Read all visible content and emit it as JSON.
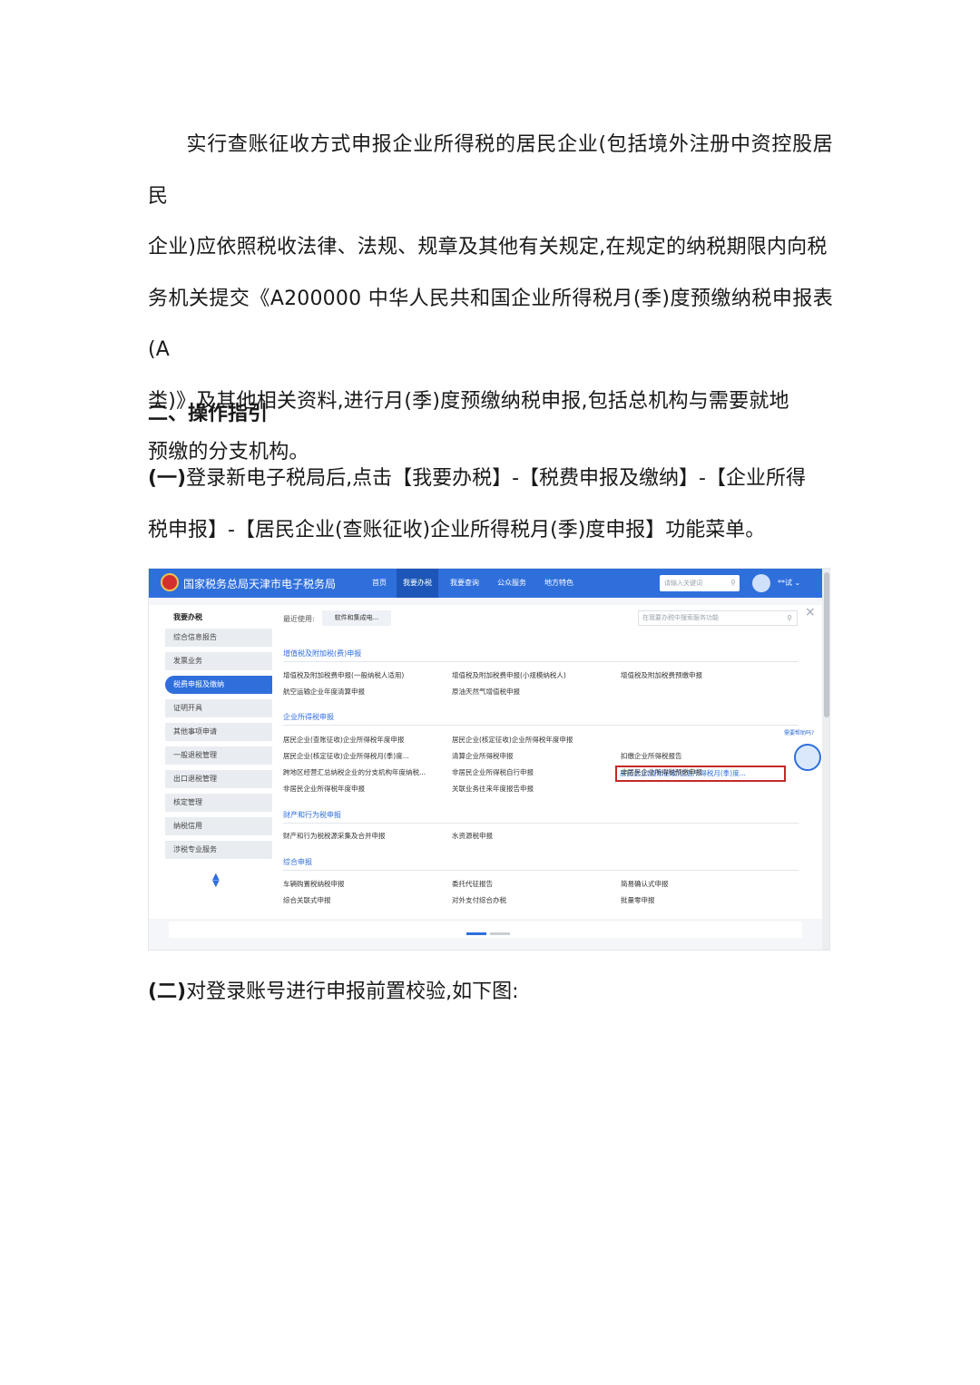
{
  "paragraph": {
    "lines": [
      "实行查账征收方式申报企业所得税的居民企业(包括境外注册中资控股居民",
      "企业)应依照税收法律、法规、规章及其他有关规定,在规定的纳税期限内向税",
      "务机关提交《A200000 中华人民共和国企业所得税月(季)度预缴纳税申报表(A",
      "类)》及其他相关资料,进行月(季)度预缴纳税申报,包括总机构与需要就地",
      "预缴的分支机构。"
    ]
  },
  "heading": "二、操作指引",
  "step1": {
    "num": "(一)",
    "line1": "登录新电子税局后,点击【我要办税】-【税费申报及缴纳】-【企业所得",
    "line2": "税申报】-【居民企业(查账征收)企业所得税月(季)度申报】功能菜单。"
  },
  "step2": {
    "num": "(二)",
    "text": "对登录账号进行申报前置校验,如下图:"
  },
  "screenshot": {
    "site_title": "国家税务总局天津市电子税务局",
    "nav": [
      "首页",
      "我要办税",
      "我要查询",
      "公众服务",
      "地方特色"
    ],
    "active_nav": "我要办税",
    "search_placeholder": "请输入关键词",
    "user": "**试",
    "sidebar_title": "我要办税",
    "sidebar": [
      "综合信息报告",
      "发票业务",
      "税费申报及缴纳",
      "证明开具",
      "其他事项申请",
      "一般退税管理",
      "出口退税管理",
      "核定管理",
      "纳税信用",
      "涉税专业服务"
    ],
    "sidebar_active": "税费申报及缴纳",
    "recent_label": "最近使用:",
    "recent_item": "软件和集成电...",
    "main_search_placeholder": "在我要办税中搜索服务功能",
    "close": "×",
    "sections": {
      "vat": {
        "title": "增值税及附加税(费)申报",
        "items": [
          "增值税及附加税费申报(一般纳税人适用)",
          "增值税及附加税费申报(小规模纳税人)",
          "增值税及附加税费预缴申报",
          "航空运输企业年度清算申报",
          "原油天然气增值税申报"
        ]
      },
      "cit": {
        "title": "企业所得税申报",
        "items": [
          "居民企业(查账征收)企业所得税年度申报",
          "居民企业(核定征收)企业所得税年度申报",
          "居民企业(查账征收)企业所得税月(季)度...",
          "居民企业(核定征收)企业所得税月(季)度...",
          "清算企业所得税申报",
          "扣缴企业所得税报告",
          "跨地区经营汇总纳税企业的分支机构年度纳税...",
          "非居民企业所得税自行申报",
          "非居民企业所得税预缴申报",
          "非居民企业所得税年度申报",
          "关联业务往来年度报告申报"
        ]
      },
      "property": {
        "title": "财产和行为税申报",
        "items": [
          "财产和行为税税源采集及合并申报",
          "水资源税申报"
        ]
      },
      "general": {
        "title": "综合申报",
        "items": [
          "车辆购置税纳税申报",
          "委托代征报告",
          "简易确认式申报",
          "综合关联式申报",
          "对外支付综合办税",
          "批量零申报"
        ]
      }
    },
    "robot_tip": "需要帮助吗?"
  },
  "colors": {
    "accent": "#2f6fdc",
    "highlight": "#c62828",
    "text": "#1a1a1a"
  }
}
